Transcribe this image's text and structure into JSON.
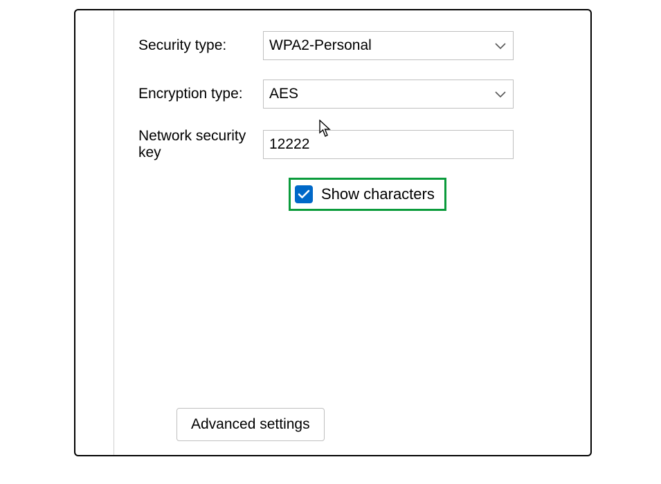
{
  "form": {
    "security_type_label": "Security type:",
    "security_type_value": "WPA2-Personal",
    "encryption_type_label": "Encryption type:",
    "encryption_type_value": "AES",
    "network_security_key_label": "Network security key",
    "network_security_key_value": "12222",
    "show_characters_label": "Show characters",
    "show_characters_checked": true
  },
  "buttons": {
    "advanced_settings": "Advanced settings"
  },
  "highlight": {
    "color": "#0a9b3b"
  }
}
